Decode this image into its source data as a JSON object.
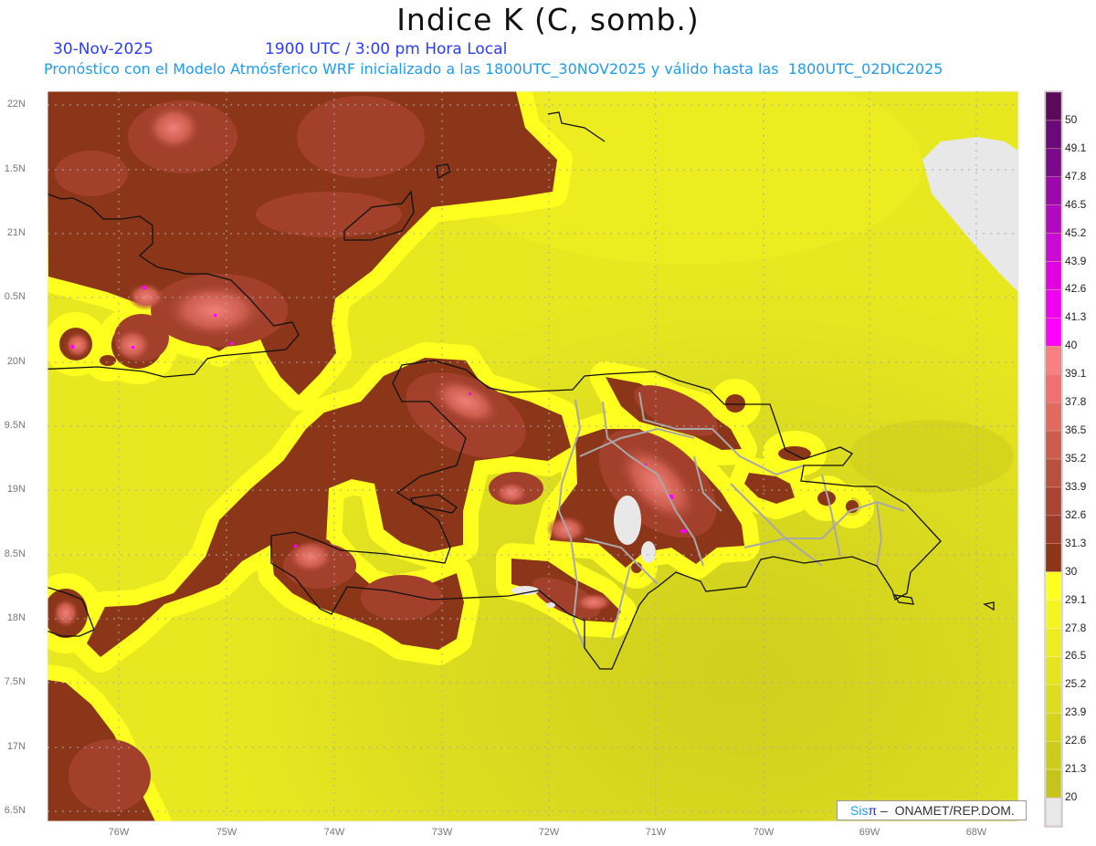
{
  "header": {
    "title": "Indice K (C, somb.)",
    "date": "30-Nov-2025",
    "time": "1900 UTC / 3:00 pm Hora Local",
    "subtitle": "Pronóstico con el Modelo Atmósferico WRF inicializado a las 1800UTC_30NOV2025 y válido hasta las  1800UTC_02DIC2025"
  },
  "axes": {
    "lat_labels": [
      "22N",
      "1.5N",
      "21N",
      "0.5N",
      "20N",
      "9.5N",
      "19N",
      "8.5N",
      "18N",
      "7.5N",
      "17N",
      "6.5N"
    ],
    "lon_labels": [
      "76W",
      "75W",
      "74W",
      "73W",
      "72W",
      "71W",
      "70W",
      "69W",
      "68W"
    ]
  },
  "colorbar": {
    "labels": [
      "50",
      "49.1",
      "47.8",
      "46.5",
      "45.2",
      "43.9",
      "42.6",
      "41.3",
      "40",
      "39.1",
      "37.8",
      "36.5",
      "35.2",
      "33.9",
      "32.6",
      "31.3",
      "30",
      "29.1",
      "27.8",
      "26.5",
      "25.2",
      "23.9",
      "22.6",
      "21.3",
      "20"
    ],
    "colors": [
      "#5a0a5a",
      "#6a0a78",
      "#7a0a8c",
      "#9a0aaa",
      "#b00ac0",
      "#c80ad2",
      "#e000e0",
      "#f000f0",
      "#ff00ff",
      "#f88080",
      "#ee7070",
      "#e06a60",
      "#cc5c4c",
      "#b85040",
      "#a84434",
      "#9a3c28",
      "#8b3519",
      "#ffff1f",
      "#f4f420",
      "#ecec20",
      "#e4e420",
      "#dcdc20",
      "#d4d41e",
      "#cccc1e",
      "#c4c41c",
      "#e8e8e8"
    ]
  },
  "credit": {
    "sis": "Sis",
    "pi": "π",
    "rest": " –  ONAMET/REP.DOM."
  }
}
